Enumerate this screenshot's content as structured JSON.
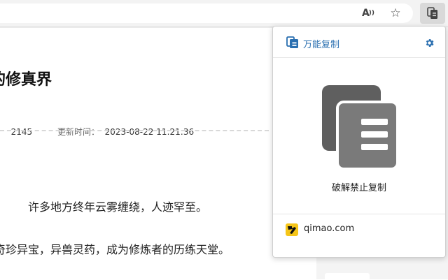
{
  "toolbar": {
    "reader_icon": "read-aloud-icon",
    "favorite_icon": "star-icon",
    "extension_icon": "copy-extension-icon"
  },
  "article": {
    "title": "的修真界",
    "meta_words_label": "：",
    "meta_words_value": "2145",
    "meta_updated_label": "更新时间：",
    "meta_updated_value": "2023-08-22 11:21:36",
    "paragraph_1": "许多地方终年云雾缠绕，人迹罕至。",
    "paragraph_2": "奇珍异宝，异兽灵药，成为修炼者的历练天堂。"
  },
  "popup": {
    "brand_name": "万能复制",
    "settings_icon": "gear-icon",
    "action_label": "破解禁止复制",
    "site": "qimao.com",
    "accent_color": "#2a6fb0"
  }
}
